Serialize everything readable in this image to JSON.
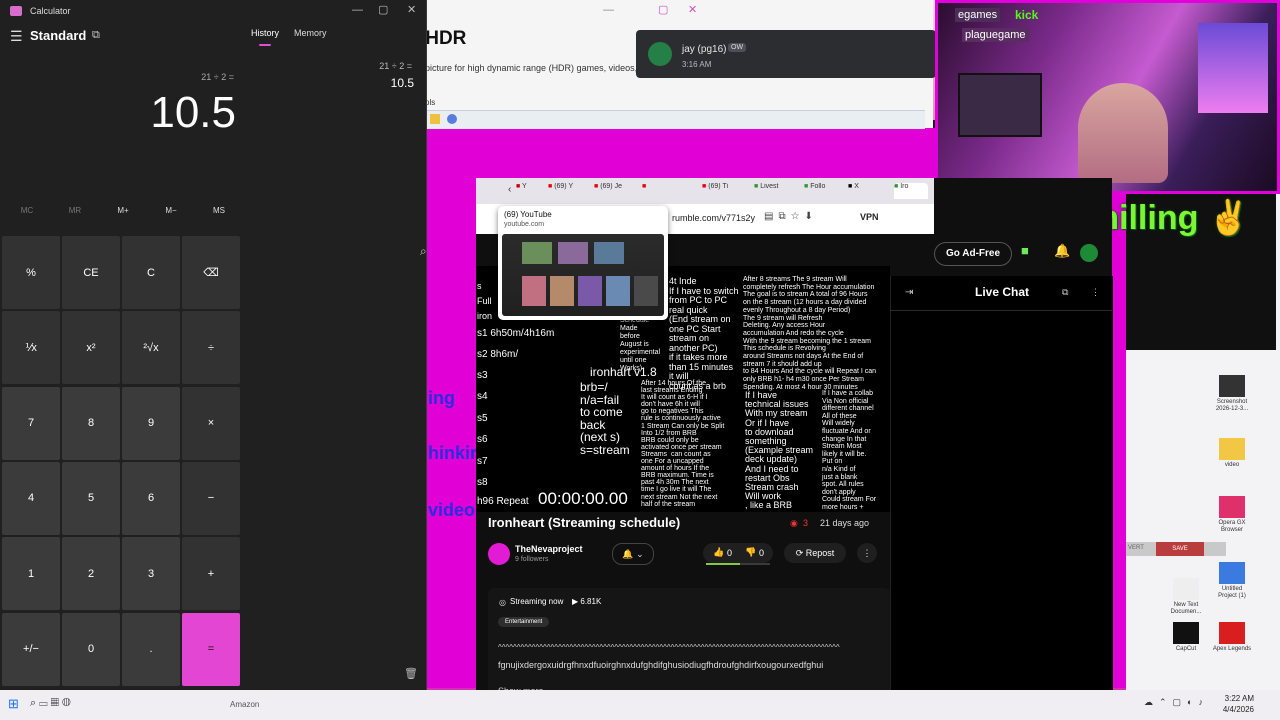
{
  "settings": {
    "breadcrumb": "y  >  HDR",
    "description": "picture for high dynamic range (HDR) games, videos, ar",
    "tools_label": "ols"
  },
  "discord": {
    "name": "jay (pg16)",
    "badge": "OW",
    "time": "3:16 AM"
  },
  "webcam": {
    "kick_label": "egames",
    "kick_brand": "kick",
    "yt_label": "plaguegame",
    "overlay_text": "Just chilling ✌"
  },
  "calculator": {
    "title": "Calculator",
    "mode": "Standard",
    "expression": "21 ÷ 2 =",
    "display": "10.5",
    "tabs": {
      "history": "History",
      "memory": "Memory"
    },
    "history": {
      "expression": "21 ÷ 2 =",
      "result": "10.5"
    },
    "memory_keys": [
      {
        "label": "MC",
        "enabled": false
      },
      {
        "label": "MR",
        "enabled": false
      },
      {
        "label": "M+",
        "enabled": true
      },
      {
        "label": "M−",
        "enabled": true
      },
      {
        "label": "MS",
        "enabled": true
      }
    ],
    "keys": [
      [
        "%",
        "CE",
        "C",
        "⌫"
      ],
      [
        "⅟x",
        "x²",
        "²√x",
        "÷"
      ],
      [
        "7",
        "8",
        "9",
        "×"
      ],
      [
        "4",
        "5",
        "6",
        "−"
      ],
      [
        "1",
        "2",
        "3",
        "+"
      ],
      [
        "+/−",
        "0",
        ".",
        "="
      ]
    ],
    "accent": "#e246d2"
  },
  "browser": {
    "tabs": [
      "Y",
      "(69) Y",
      "(69) Je",
      "",
      "(69) Ti",
      "Livest",
      "Follo",
      "X",
      "Iro"
    ],
    "tooltip": {
      "title": "(69) YouTube",
      "domain": "youtube.com"
    },
    "url": "rumble.com/v771s2y",
    "vpn": "VPN"
  },
  "rumble": {
    "ad_free": "Go Ad-Free",
    "video_title": "Ironheart (Streaming schedule)",
    "views": "3",
    "age": "21 days ago",
    "timer": "00:00:00.00",
    "channel": "TheNevaproject",
    "followers": "9 followers",
    "likes": "0",
    "dislikes": "0",
    "repost": "Repost",
    "streaming_now": "Streaming now",
    "watch_count": "6.81K",
    "category": "Entertainment",
    "desc_line1": "^^^^^^^^^^^^^^^^^^^^^^^^^^^^^^^^^^^^^^^^^^^^^^^^^^^^^^^^^^^^^^^^^^^^^^^^^^^^^^^^^^^^^^^^^^^",
    "desc_line2": "fgnujixdergoxuidrgfhnxdfuoirghnxdufghdifghusiodiugfhdroufghdirfxougourxedfghui",
    "show_more": "Show more",
    "live_chat": "Live Chat",
    "video_text": {
      "left_col": "s\nFull\niron",
      "s1": "s1 6h50m/4h16m",
      "s2": "s2 8h6m/",
      "s_list": "s3\n\ns4\n\ns5\n\ns6\n\ns7\n\ns8",
      "h96": "h96 Repeat",
      "ironhart": "ironhart v1.8",
      "brb": "brb=/\nn/a=fail\nto come\nback\n(next s)\ns=stream",
      "col2": "4t Inde\nIf I have to switch\nfrom PC to PC\nreal quick\n(End stream on\none PC Start\nstream on\nanother PC)\nif it takes more\nthan 15 minutes\nit will\ncount as a brb",
      "col1b": "Schedule\nMade\nbefore\nAugust is\nexperimental\nuntil one\nWorks)",
      "col2b": "After 14 hours Of the\nlast streams Ending\nIt will count as 6-H if I\ndon't have 6h it will\ngo to negatives This\nrule is continuously active\n1 Stream Can only be Split\nInto 1/2 from BRB\nBRB could only be\nactivated once per stream\nStreams  can count as\none For a uncapped\namount of hours If the\nBRB maximum. Time is\npast 4h 30m The next\ntime I go live it will The\nnext stream Not the next\nhalf of the stream",
      "col3": "After 8 streams The 9 stream Will\ncompletely refresh The Hour accumulation\nThe goal is to stream A total of 96 Hours\non the 8 stream (12 hours a day divided\nevenly Throughout a 8 day Period)\nThe 9 stream will Refresh\nDeleting. Any access Hour\naccumulation And redo the cycle\nWith the 9 stream becoming the 1 stream\nThis schedule is Revolving\naround Streams not days At the End of\nstream 7 it should add up\nto 84 Hours And the cycle will Repeat I can\nonly BRB h1- h4 m30 once Per Stream\nSpending. At most 4 hour 30 minutes",
      "col3b": "If I have\ntechnical issues\nWith my stream\nOr if I have\nto download\nsomething\n(Example stream\ndeck update)\nAnd I need to\nrestart Obs\nStream crash\nWill work\n, like a BRB",
      "col4": "If I have a collab\nVia Non official\ndifferent channel\nAll of these\nWill widely\nfluctuate And or\nchange In that\nStream Most\nlikely it will be.\nPut on\nn/a Kind of\njust a blank\nspot. All rules\ndon't apply\nCould stream For\nmore hours +"
    }
  },
  "side_texts": [
    "ing",
    "hinkir",
    "video"
  ],
  "desktop_icons": [
    {
      "label": "Screenshot 2026-12-3...",
      "color": "#333333"
    },
    {
      "label": "video",
      "color": "#f2c744"
    },
    {
      "label": "Opera GX Browser",
      "color": "#e0306b"
    },
    {
      "label": "New Text Documen...",
      "color": "#eeeeee"
    },
    {
      "label": "Untitled Project (1)",
      "color": "#3b7be0"
    },
    {
      "label": "CapCut",
      "color": "#111111"
    },
    {
      "label": "Apex Legends",
      "color": "#d81e1e"
    }
  ],
  "obs": {
    "revert": "VERT",
    "save": "SAVE"
  },
  "taskbar": {
    "amazon": "Amazon",
    "time": "3:22 AM",
    "date": "4/4/2026"
  }
}
